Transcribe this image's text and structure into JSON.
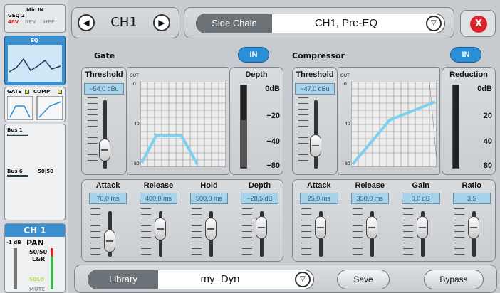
{
  "channel_strip": {
    "input_name": "Mic IN",
    "geq": "GEQ 2",
    "flags": [
      "48V",
      "REV",
      "HPF"
    ],
    "eq_label": "EQ",
    "gate_label": "GATE",
    "comp_label": "COMP",
    "bus1_label": "Bus 1",
    "bus6_label": "Bus 6",
    "bus6_value": "50|50",
    "channel_label": "CH 1",
    "level": "-1 dB",
    "pan_label": "PAN",
    "pan_value": "50/50",
    "pan_mode": "L&R",
    "solo_label": "SOLO",
    "mute_label": "MUTE"
  },
  "header": {
    "channel": "CH1",
    "side_chain_label": "Side Chain",
    "side_chain_value": "CH1, Pre-EQ",
    "close_symbol": "X"
  },
  "gate": {
    "title": "Gate",
    "in_label": "IN",
    "threshold_label": "Threshold",
    "threshold_value": "−54,0 dBu",
    "depth_label": "Depth",
    "depth_scale": [
      "0dB",
      "−20",
      "−40",
      "−80"
    ],
    "graph_out": "OUT",
    "graph_ticks": [
      "0",
      "−40",
      "−80"
    ],
    "params": [
      {
        "label": "Attack",
        "value": "70,0 ms",
        "fader": 0.72
      },
      {
        "label": "Release",
        "value": "400,0 ms",
        "fader": 0.25
      },
      {
        "label": "Hold",
        "value": "500,0 ms",
        "fader": 0.25
      },
      {
        "label": "Depth",
        "value": "−28,5 dB",
        "fader": 0.2
      }
    ]
  },
  "compressor": {
    "title": "Compressor",
    "in_label": "IN",
    "threshold_label": "Threshold",
    "threshold_value": "−47,0 dBu",
    "reduction_label": "Reduction",
    "reduction_scale": [
      "0dB",
      "20",
      "40",
      "80"
    ],
    "graph_out": "OUT",
    "graph_ticks": [
      "0",
      "−40",
      "−80"
    ],
    "params": [
      {
        "label": "Attack",
        "value": "25,0 ms",
        "fader": 0.2
      },
      {
        "label": "Release",
        "value": "350,0 ms",
        "fader": 0.2
      },
      {
        "label": "Gain",
        "value": "0,0 dB",
        "fader": 0.2
      },
      {
        "label": "Ratio",
        "value": "3,5",
        "fader": 0.2
      }
    ]
  },
  "footer": {
    "library_label": "Library",
    "library_value": "my_Dyn",
    "save_label": "Save",
    "bypass_label": "Bypass"
  },
  "colors": {
    "accent": "#2a8fd6",
    "close": "#d9232a",
    "curve": "#7fd0ef"
  }
}
